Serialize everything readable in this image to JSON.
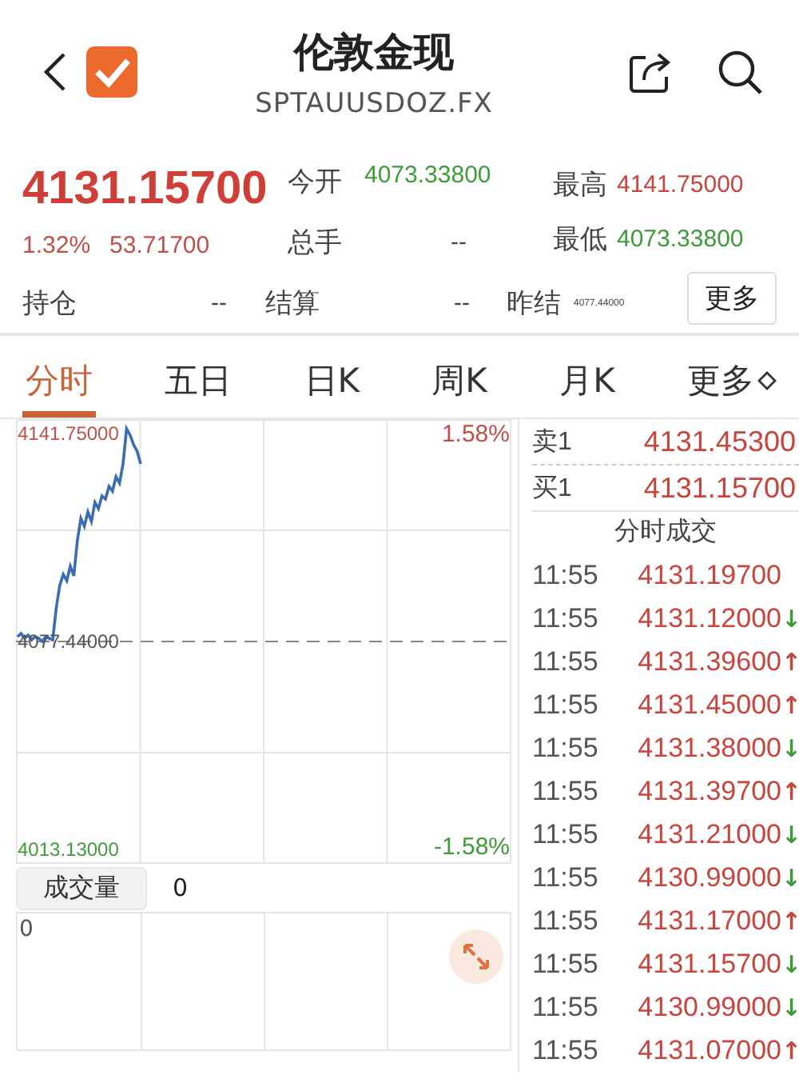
{
  "header": {
    "title": "伦敦金现",
    "subtitle": "SPTAUUSDOZ.FX"
  },
  "quote": {
    "price": "4131.15700",
    "change_pct": "1.32%",
    "change": "53.71700",
    "fields": [
      {
        "label": "今开",
        "value": "4073.33800",
        "color": "#3e9b3a"
      },
      {
        "label": "最高",
        "value": "4141.75000",
        "color": "#c8453d"
      },
      {
        "label": "总手",
        "value": "--",
        "color": "#444444"
      },
      {
        "label": "最低",
        "value": "4073.33800",
        "color": "#3e9b3a"
      },
      {
        "label": "持仓",
        "value": "--",
        "color": "#444444"
      },
      {
        "label": "结算",
        "value": "--",
        "color": "#444444"
      },
      {
        "label": "昨结",
        "value": "4077.44000",
        "color": "#444444"
      }
    ],
    "more_button": "更多"
  },
  "tabs": [
    {
      "label": "分时",
      "selected": true
    },
    {
      "label": "五日",
      "selected": false
    },
    {
      "label": "日K",
      "selected": false
    },
    {
      "label": "周K",
      "selected": false
    },
    {
      "label": "月K",
      "selected": false
    },
    {
      "label": "更多",
      "selected": false
    }
  ],
  "chart": {
    "top_pct": "1.58%",
    "bottom_pct": "-1.58%",
    "axis_labels": [
      "4141.75000",
      "4077.44000",
      "4013.13000"
    ]
  },
  "order_book": [
    {
      "label": "卖1",
      "price": "4131.45300"
    },
    {
      "label": "买1",
      "price": "4131.15700"
    }
  ],
  "trades_title": "分时成交",
  "trades": [
    {
      "time": "11:55",
      "price": "4131.19700"
    },
    {
      "time": "11:55",
      "price": "4131.12000",
      "arrow": "↓",
      "color": "#3e9b3a"
    },
    {
      "time": "11:55",
      "price": "4131.39600",
      "arrow": "↑",
      "color": "#c8453d"
    },
    {
      "time": "11:55",
      "price": "4131.45000",
      "arrow": "↑",
      "color": "#c8453d"
    },
    {
      "time": "11:55",
      "price": "4131.38000",
      "arrow": "↓",
      "color": "#3e9b3a"
    },
    {
      "time": "11:55",
      "price": "4131.39700",
      "arrow": "↑",
      "color": "#c8453d"
    },
    {
      "time": "11:55",
      "price": "4131.21000",
      "arrow": "↓",
      "color": "#3e9b3a"
    },
    {
      "time": "11:55",
      "price": "4130.99000",
      "arrow": "↓",
      "color": "#3e9b3a"
    },
    {
      "time": "11:55",
      "price": "4131.17000",
      "arrow": "↑",
      "color": "#c8453d"
    },
    {
      "time": "11:55",
      "price": "4131.15700",
      "arrow": "↓",
      "color": "#3e9b3a"
    },
    {
      "time": "11:55",
      "price": "4130.99000",
      "arrow": "↓",
      "color": "#3e9b3a"
    },
    {
      "time": "11:55",
      "price": "4131.07000",
      "arrow": "↑",
      "color": "#c8453d"
    }
  ],
  "volume": {
    "label": "成交量",
    "value": "0",
    "axis_label": "0"
  }
}
